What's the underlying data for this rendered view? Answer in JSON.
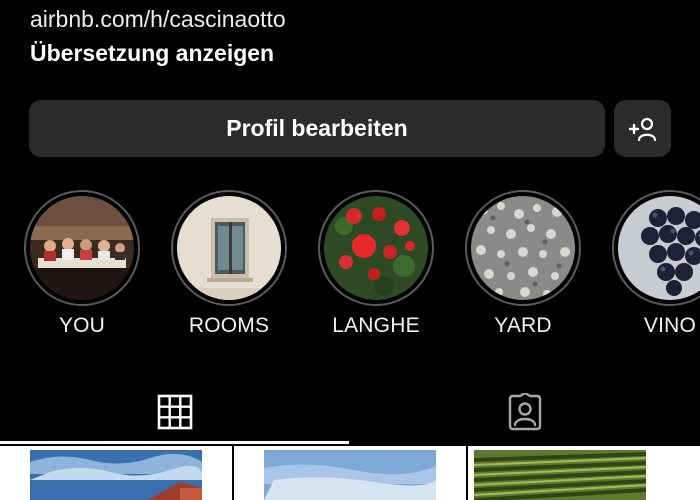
{
  "bio": {
    "cut_line": "",
    "link": "airbnb.com/h/cascinaotto",
    "translate": "Übersetzung anzeigen"
  },
  "actions": {
    "edit_profile": "Profil bearbeiten",
    "add_person_icon": "add-person-icon"
  },
  "highlights": [
    {
      "label": "YOU",
      "icon": "dinner-group-photo"
    },
    {
      "label": "ROOMS",
      "icon": "window-photo"
    },
    {
      "label": "LANGHE",
      "icon": "red-roses-photo"
    },
    {
      "label": "YARD",
      "icon": "gravel-photo"
    },
    {
      "label": "VINO",
      "icon": "grapes-photo"
    }
  ],
  "tabs": [
    {
      "name": "posts-grid",
      "icon": "grid-icon",
      "active": true
    },
    {
      "name": "tagged",
      "icon": "tagged-person-icon",
      "active": false
    }
  ],
  "posts": [
    {
      "icon": "villa-sky-photo"
    },
    {
      "icon": "blue-sky-photo"
    },
    {
      "icon": "vineyard-photo"
    }
  ],
  "colors": {
    "background": "#000000",
    "button": "#2b2b2b",
    "ring": "#5a5a5a",
    "text": "#ffffff"
  }
}
